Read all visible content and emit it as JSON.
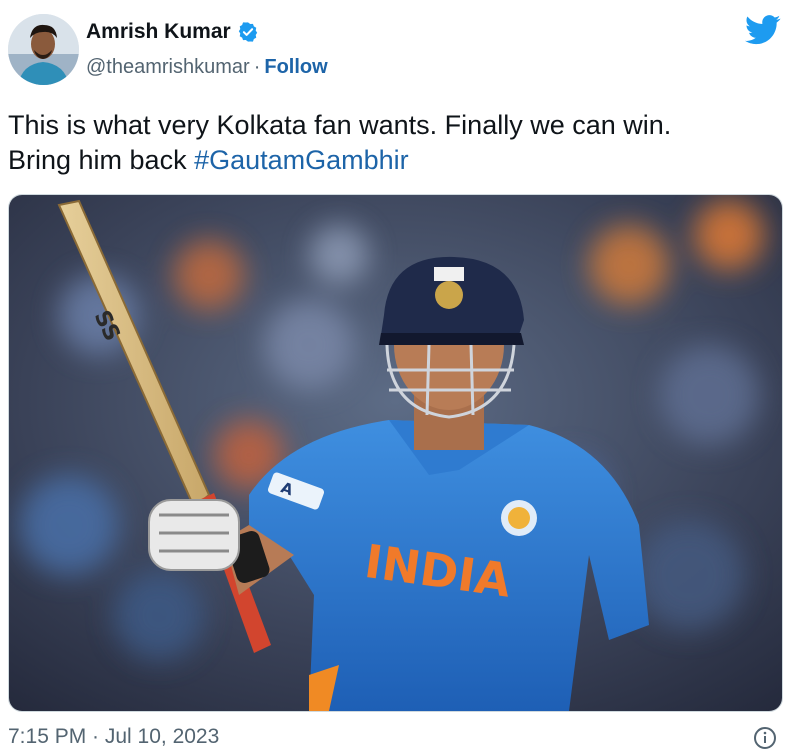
{
  "author": {
    "display_name": "Amrish Kumar",
    "handle": "@theamrishkumar",
    "separator": "·",
    "follow_label": "Follow",
    "verified": true
  },
  "tweet": {
    "text_line1": "This is what very Kolkata fan wants. Finally we can win.",
    "text_line2_prefix": "Bring him back ",
    "hashtag": "#GautamGambhir"
  },
  "media": {
    "jersey_text": "INDIA",
    "bat_brand": "SS",
    "sleeve_badge": "A"
  },
  "meta": {
    "timestamp": "7:15 PM · Jul 10, 2023"
  },
  "icons": {
    "verified": "verified-badge-icon",
    "platform": "twitter-bird-icon",
    "info": "info-icon"
  },
  "colors": {
    "link": "#1d64a8",
    "twitter_blue": "#1d9bf0",
    "secondary_text": "#536471"
  }
}
